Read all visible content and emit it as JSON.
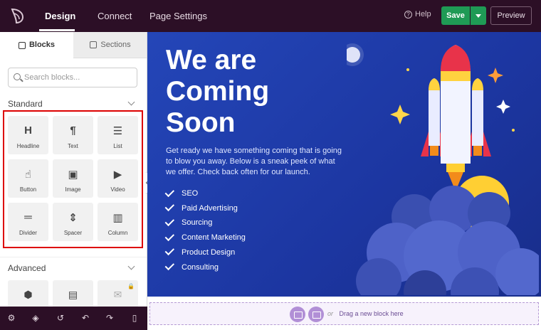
{
  "topbar": {
    "tabs": [
      {
        "label": "Design",
        "active": true
      },
      {
        "label": "Connect",
        "active": false
      },
      {
        "label": "Page Settings",
        "active": false
      }
    ],
    "help_label": "Help",
    "save_label": "Save",
    "preview_label": "Preview"
  },
  "sidebar": {
    "tabs": [
      {
        "label": "Blocks",
        "active": true
      },
      {
        "label": "Sections",
        "active": false
      }
    ],
    "search_placeholder": "Search blocks...",
    "standard": {
      "title": "Standard",
      "blocks": [
        {
          "label": "Headline",
          "glyph": "H",
          "icon": "headline-icon"
        },
        {
          "label": "Text",
          "glyph": "¶",
          "icon": "text-icon"
        },
        {
          "label": "List",
          "glyph": "☰",
          "icon": "list-icon"
        },
        {
          "label": "Button",
          "glyph": "☝",
          "icon": "button-icon"
        },
        {
          "label": "Image",
          "glyph": "▣",
          "icon": "image-icon"
        },
        {
          "label": "Video",
          "glyph": "▶",
          "icon": "video-icon"
        },
        {
          "label": "Divider",
          "glyph": "═",
          "icon": "divider-icon"
        },
        {
          "label": "Spacer",
          "glyph": "⇕",
          "icon": "spacer-icon"
        },
        {
          "label": "Column",
          "glyph": "▥",
          "icon": "column-icon"
        }
      ]
    },
    "advanced": {
      "title": "Advanced"
    },
    "tools": [
      "settings-icon",
      "layers-icon",
      "history-icon",
      "undo-icon",
      "redo-icon",
      "mobile-preview-icon"
    ]
  },
  "canvas": {
    "headline_lines": [
      "We are",
      "Coming",
      "Soon"
    ],
    "intro": "Get ready we have something coming that is going to blow you away. Below is a sneak peek of what we offer. Check back often for our launch.",
    "features": [
      "SEO",
      "Paid Advertising",
      "Sourcing",
      "Content Marketing",
      "Product Design",
      "Consulting"
    ]
  },
  "dropzone": {
    "or_label": "or",
    "text": "Drag a new block here"
  },
  "colors": {
    "topbar_bg": "#2c0f26",
    "save_green": "#1f9a55",
    "canvas_blue": "#2446b8",
    "highlight_red": "#dd0000"
  }
}
